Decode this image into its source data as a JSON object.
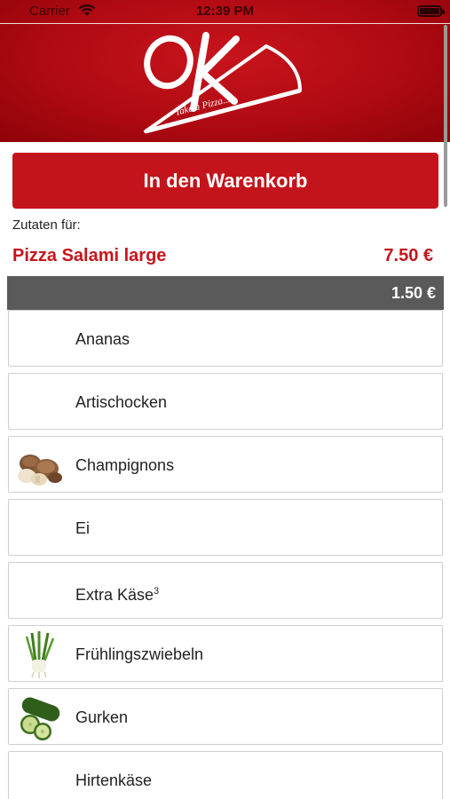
{
  "status_bar": {
    "carrier": "Carrier",
    "time": "12:39 PM"
  },
  "logo": {
    "text": "OK",
    "tagline": "Take a Pizza..."
  },
  "cart_button_label": "In den Warenkorb",
  "zutaten_label": "Zutaten für:",
  "product": {
    "name": "Pizza Salami large",
    "price": "7.50 €"
  },
  "section_price": "1.50 €",
  "ingredients": [
    {
      "name": "Ananas",
      "icon": "none"
    },
    {
      "name": "Artischocken",
      "icon": "none"
    },
    {
      "name": "Champignons",
      "icon": "mushroom-icon"
    },
    {
      "name": "Ei",
      "icon": "none"
    },
    {
      "name": "Extra Käse",
      "footnote": "3",
      "icon": "none"
    },
    {
      "name": "Frühlingszwiebeln",
      "icon": "spring-onion-icon"
    },
    {
      "name": "Gurken",
      "icon": "cucumber-icon"
    },
    {
      "name": "Hirtenkäse",
      "icon": "none"
    }
  ],
  "colors": {
    "brand_red": "#c8141c",
    "header_red": "#b00a12",
    "section_gray": "#5a5a5a"
  }
}
